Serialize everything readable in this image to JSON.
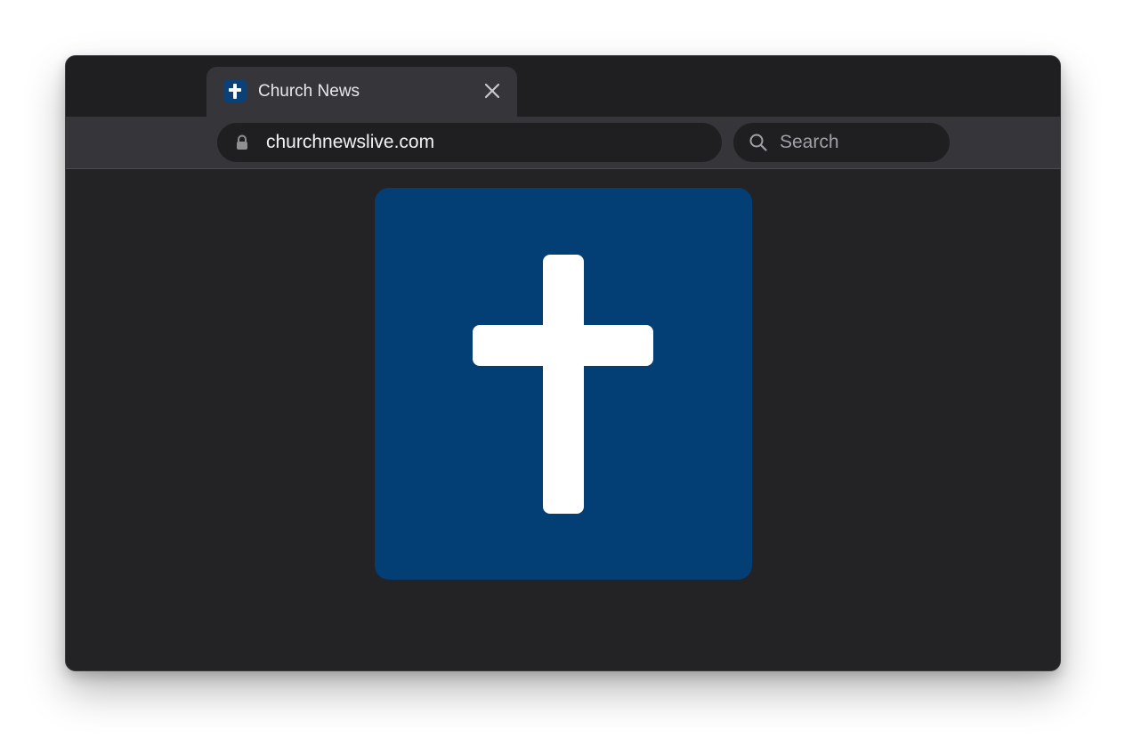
{
  "browser": {
    "tab": {
      "title": "Church News",
      "favicon_icon": "cross-icon",
      "close_icon": "close-icon"
    },
    "address_bar": {
      "url": "churchnewslive.com",
      "secure_icon": "lock-icon"
    },
    "search": {
      "placeholder": "Search",
      "icon": "search-icon"
    }
  },
  "page": {
    "logo": {
      "icon": "cross-icon",
      "background_color": "#033f74",
      "symbol_color": "#ffffff"
    }
  },
  "colors": {
    "window_background": "#232326",
    "toolbar": "#36363a",
    "field_background": "#1f1f22"
  }
}
